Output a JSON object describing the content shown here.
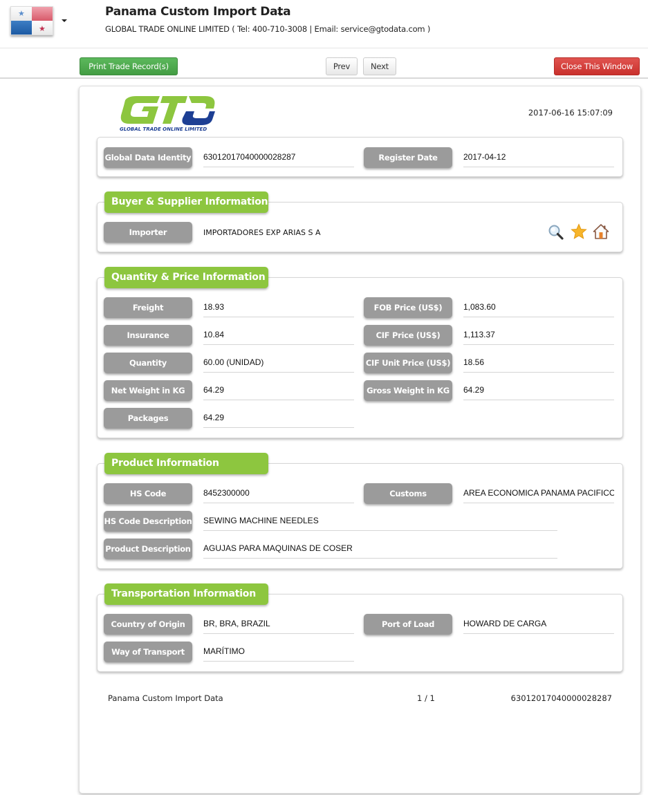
{
  "header": {
    "title": "Panama Custom Import Data",
    "company_line": "GLOBAL TRADE ONLINE LIMITED ( Tel: 400-710-3008 | Email: service@gtodata.com )",
    "flag_icon": "panama-flag-icon"
  },
  "toolbar": {
    "print_label": "Print Trade Record(s)",
    "prev_label": "Prev",
    "next_label": "Next",
    "close_label": "Close This Window"
  },
  "colors": {
    "primary_green": "#8dc63f",
    "print_green": "#5cb85c",
    "close_red": "#d9534f",
    "label_gray": "#9b9b9b",
    "logo_blue": "#1d3f94"
  },
  "document": {
    "logo_text": "GLOBAL TRADE  ONLINE LIMITED",
    "timestamp": "2017-06-16 15:07:09",
    "identity": {
      "global_data_identity_label": "Global Data Identity",
      "global_data_identity_value": "63012017040000028287",
      "register_date_label": "Register Date",
      "register_date_value": "2017-04-12"
    },
    "buyer_supplier": {
      "title": "Buyer & Supplier Information",
      "importer_label": "Importer",
      "importer_value": "IMPORTADORES EXP ARIAS S A",
      "icons": [
        "search-icon",
        "star-icon",
        "home-icon"
      ]
    },
    "quantity_price": {
      "title": "Quantity & Price Information",
      "freight_label": "Freight",
      "freight_value": "18.93",
      "fob_label": "FOB Price (US$)",
      "fob_value": "1,083.60",
      "insurance_label": "Insurance",
      "insurance_value": "10.84",
      "cif_label": "CIF Price (US$)",
      "cif_value": "1,113.37",
      "quantity_label": "Quantity",
      "quantity_value": "60.00 (UNIDAD)",
      "cif_unit_label": "CIF Unit Price (US$)",
      "cif_unit_value": "18.56",
      "net_weight_label": "Net Weight in KG",
      "net_weight_value": "64.29",
      "gross_weight_label": "Gross Weight in KG",
      "gross_weight_value": "64.29",
      "packages_label": "Packages",
      "packages_value": "64.29"
    },
    "product": {
      "title": "Product Information",
      "hs_code_label": "HS Code",
      "hs_code_value": "8452300000",
      "customs_label": "Customs",
      "customs_value": "AREA ECONOMICA PANAMA PACIFICO(",
      "hs_desc_label": "HS Code Description",
      "hs_desc_value": "SEWING MACHINE NEEDLES",
      "product_desc_label": "Product Description",
      "product_desc_value": "AGUJAS PARA MAQUINAS DE COSER"
    },
    "transportation": {
      "title": "Transportation Information",
      "origin_label": "Country of Origin",
      "origin_value": "BR, BRA, BRAZIL",
      "port_label": "Port of Load",
      "port_value": "HOWARD DE CARGA",
      "transport_label": "Way of Transport",
      "transport_value": "MARÍTIMO"
    },
    "footer": {
      "left": "Panama Custom Import Data",
      "page": "1 / 1",
      "right": "63012017040000028287"
    }
  }
}
